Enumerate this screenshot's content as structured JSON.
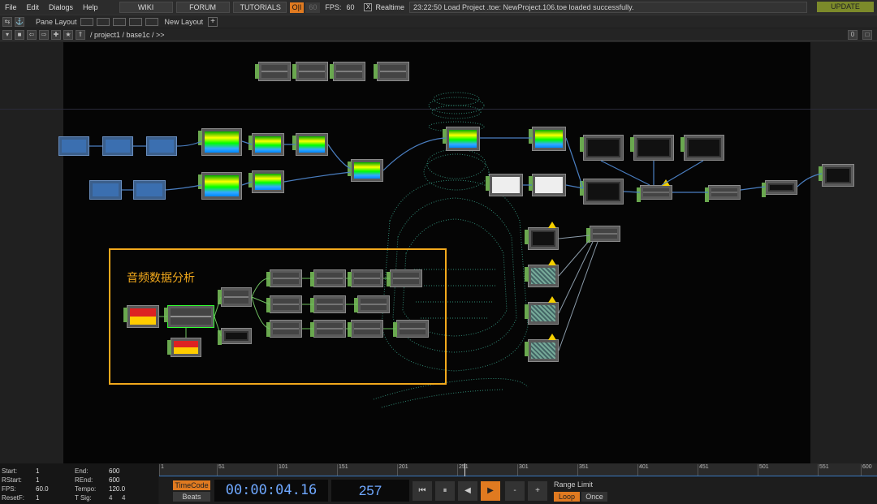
{
  "menu": {
    "items": [
      "File",
      "Edit",
      "Dialogs",
      "Help"
    ],
    "wiki": "WIKI",
    "forum": "FORUM",
    "tutorials": "TUTORIALS",
    "perf_label": "O|I",
    "fps_cap": "60",
    "fps_label": "FPS:",
    "fps_value": "60",
    "realtime_check": "X",
    "realtime_label": "Realtime",
    "status_message": "23:22:50 Load Project .toe: NewProject.106.toe loaded successfully.",
    "update_label": "UPDATE"
  },
  "panebar": {
    "pane_layout_label": "Pane Layout",
    "new_layout_label": "New Layout",
    "plus": "+"
  },
  "pathbar": {
    "path": "/ project1 / base1c / >>",
    "right_buttons": [
      "0",
      "□"
    ]
  },
  "network": {
    "analysis_label": "音频数据分析",
    "accent": "#f2a91c"
  },
  "range": {
    "start_k": "Start:",
    "start_v": "1",
    "end_k": "End:",
    "end_v": "600",
    "rstart_k": "RStart:",
    "rstart_v": "1",
    "rend_k": "REnd:",
    "rend_v": "600",
    "fps_k": "FPS:",
    "fps_v": "60.0",
    "tempo_k": "Tempo:",
    "tempo_v": "120.0",
    "resetf_k": "ResetF:",
    "resetf_v": "1",
    "tsig_k": "T Sig:",
    "tsig_v1": "4",
    "tsig_v2": "4"
  },
  "timeline": {
    "ticks": [
      "1",
      "51",
      "101",
      "151",
      "201",
      "251",
      "301",
      "351",
      "401",
      "451",
      "501",
      "551",
      "600"
    ],
    "timecode_label": "TimeCode",
    "beats_label": "Beats",
    "timecode": "00:00:04.16",
    "frame": "257",
    "buttons": [
      "⏮",
      "⏸",
      "◀",
      "▶",
      "-",
      "+"
    ],
    "range_limit_label": "Range Limit",
    "loop_label": "Loop",
    "once_label": "Once"
  }
}
